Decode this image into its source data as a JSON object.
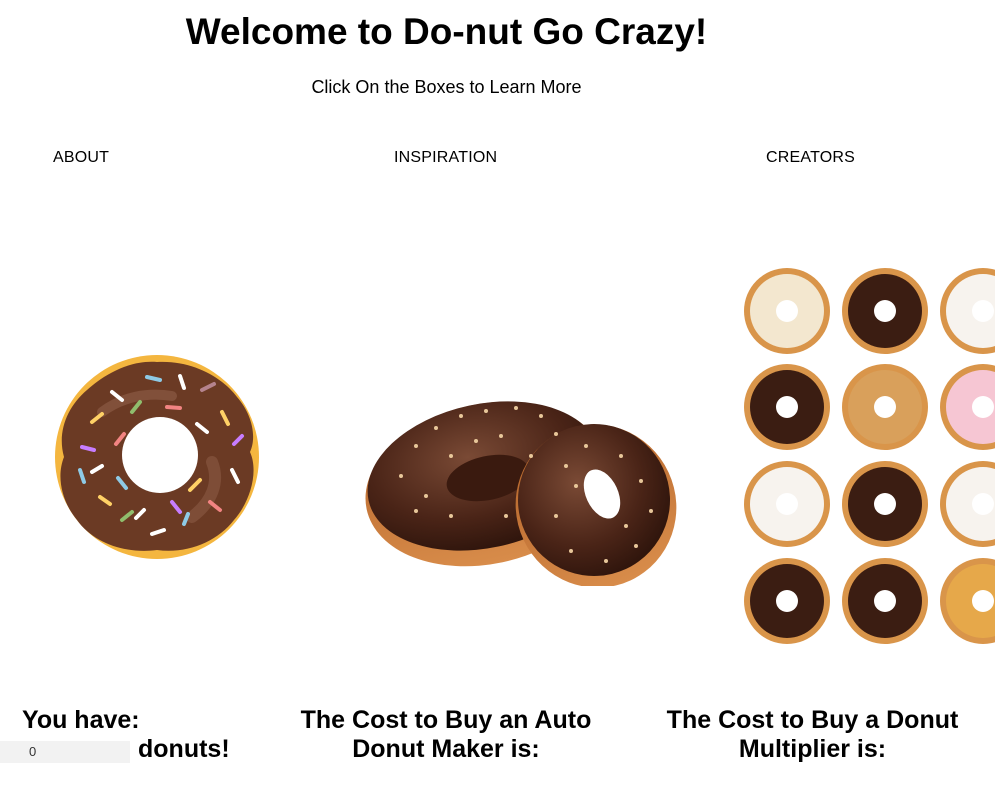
{
  "header": {
    "title": "Welcome to Do-nut Go Crazy!",
    "subtitle": "Click On the Boxes to Learn More"
  },
  "nav": {
    "about": "ABOUT",
    "inspiration": "INSPIRATION",
    "creators": "CREATORS"
  },
  "stats": {
    "you_have": "You have:",
    "donut_count": "0",
    "donuts_suffix": "donuts!",
    "auto_maker_cost": "The Cost to Buy an Auto Donut Maker is:",
    "multiplier_cost": "The Cost to Buy a Donut Multiplier is:"
  },
  "colors": {
    "dough": "#f4b63f",
    "chocolate": "#6b3a24",
    "dark_chocolate": "#3b1d12",
    "frosting_white": "#f7f3ee",
    "frosting_pink": "#f6b3c6"
  },
  "images": {
    "about": "cartoon-sprinkle-donut",
    "inspiration": "chocolate-glazed-donuts-photo",
    "creators": "donut-assortment-grid"
  }
}
